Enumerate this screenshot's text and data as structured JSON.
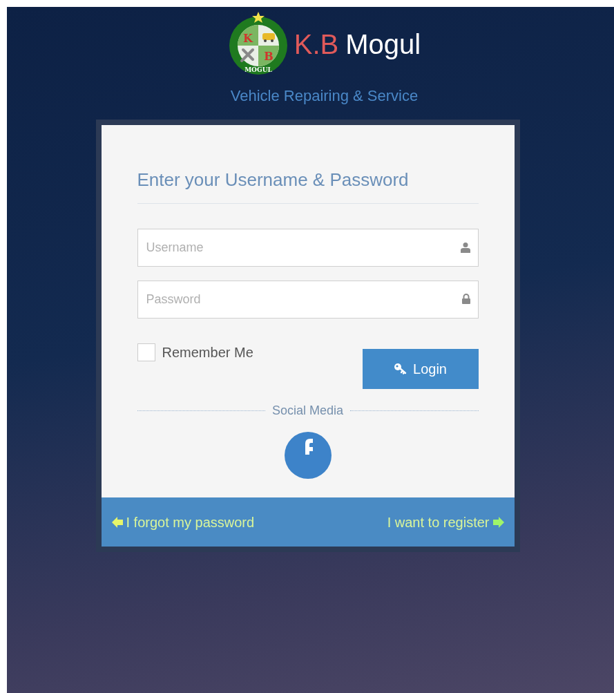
{
  "logo": {
    "letters": [
      "K",
      "B"
    ],
    "ring_text": "MOGUL"
  },
  "brand": {
    "first": "K.B",
    "second": "Mogul"
  },
  "tagline": "Vehicle Repairing & Service",
  "form": {
    "heading": "Enter your Username & Password",
    "fields": [
      {
        "kind": "user",
        "placeholder": "Username"
      },
      {
        "kind": "lock",
        "placeholder": "Password"
      }
    ],
    "remember": {
      "label": "Remember Me",
      "checked": false
    },
    "login_button": "Login",
    "social_heading": "Social Media"
  },
  "footer": {
    "forgot": "I forgot my password",
    "register": "I want to register"
  }
}
